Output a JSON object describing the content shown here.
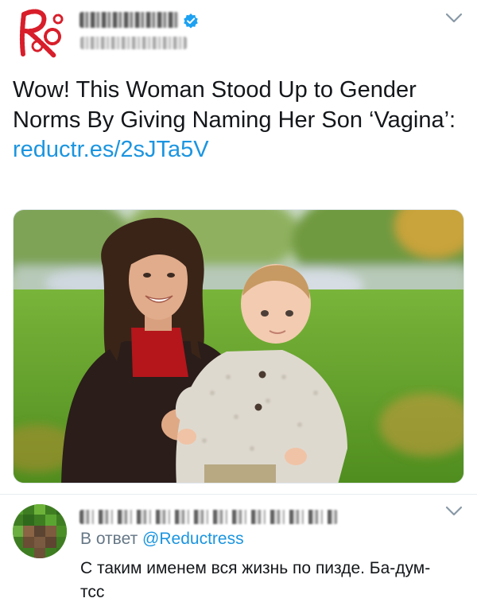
{
  "main_tweet": {
    "text": "Wow! This Woman Stood Up to Gender Norms By Giving Naming Her Son ‘Vagina’: ",
    "link": "reductr.es/2sJTa5V",
    "verified_icon": "verified-badge-icon",
    "menu_icon": "chevron-down-icon"
  },
  "photo": {
    "icon": "photo-mother-and-baby-in-park"
  },
  "reply": {
    "reply_prefix": "В ответ",
    "mention": "@Reductress",
    "text": "С таким именем вся жизнь по пизде. Ба-дум-тсс",
    "menu_icon": "chevron-down-icon"
  },
  "colors": {
    "link_blue": "#1b95e0",
    "secondary_text": "#657786",
    "verified_blue": "#1da1f2"
  }
}
